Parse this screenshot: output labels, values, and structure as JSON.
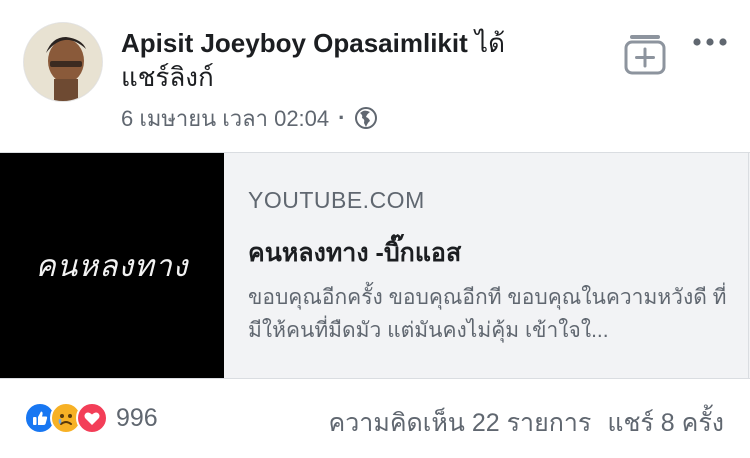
{
  "post": {
    "author": "Apisit Joeyboy Opasaimlikit",
    "action_line1": " ได้",
    "action_line2": "แชร์ลิงก์",
    "timestamp": "6 เมษายน เวลา 02:04",
    "separator": "·",
    "privacy_icon": "globe-icon",
    "avatar_icon": "avatar",
    "save_icon": "save-to-collection-icon",
    "more_icon": "more-options-icon"
  },
  "link": {
    "thumbnail_text": "คนหลงทาง",
    "domain": "YOUTUBE.COM",
    "title": "คนหลงทาง -บิ๊กแอส",
    "description": "ขอบคุณอีกครั้ง ขอบคุณอีกที ขอบคุณในความหวังดี ที่มีให้คนที่มืดมัว แต่มันคงไม่คุ้ม เข้าใจใ..."
  },
  "engagement": {
    "reactions": [
      "like-icon",
      "sad-icon",
      "love-icon"
    ],
    "colors": {
      "like": "#1877f2",
      "sad": "#f7b125",
      "love": "#f33e58"
    },
    "reaction_count": "996",
    "comments": "ความคิดเห็น 22 รายการ",
    "shares": "แชร์ 8 ครั้ง"
  }
}
